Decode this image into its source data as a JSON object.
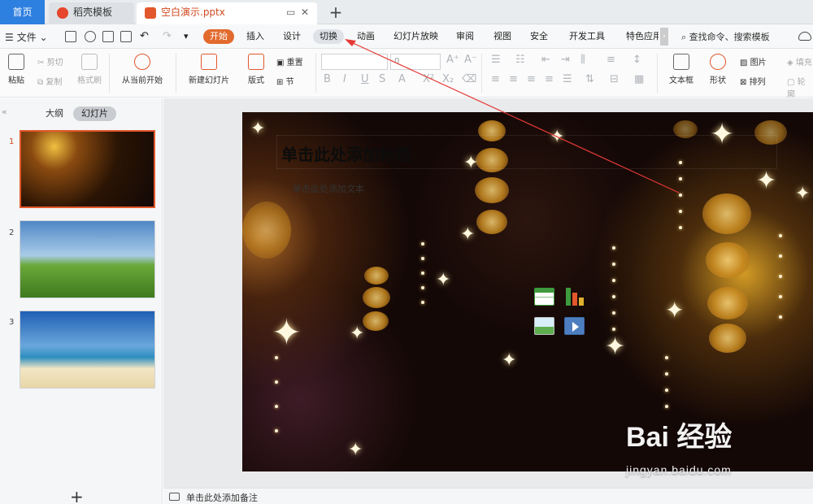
{
  "tabs": {
    "home": "首页",
    "template": "稻壳模板",
    "document": "空白演示.pptx"
  },
  "menu": {
    "file": "文件",
    "items": [
      "开始",
      "插入",
      "设计",
      "切换",
      "动画",
      "幻灯片放映",
      "审阅",
      "视图",
      "安全",
      "开发工具",
      "特色应用"
    ],
    "search": "查找命令、搜索模板",
    "active": "开始",
    "pointed": "切换"
  },
  "ribbon": {
    "paste": "粘贴",
    "cut": "剪切",
    "copy": "复制",
    "format_painter": "格式刷",
    "from_current": "从当前开始",
    "new_slide": "新建幻灯片",
    "layout": "版式",
    "reset": "重置",
    "section": "节",
    "font_size": "0",
    "text_box": "文本框",
    "shape": "形状",
    "picture": "图片",
    "arrange": "排列",
    "fill": "填充",
    "outline": "轮廓"
  },
  "panel": {
    "outline_tab": "大纲",
    "slides_tab": "幻灯片",
    "slides": [
      {
        "number": "1",
        "theme": "golden-lights"
      },
      {
        "number": "2",
        "theme": "landscape"
      },
      {
        "number": "3",
        "theme": "beach"
      }
    ],
    "add_icon": "+"
  },
  "slide": {
    "title_placeholder": "单击此处添加标题",
    "subtitle_placeholder": "单击此处添加文本"
  },
  "notes": {
    "placeholder": "单击此处添加备注"
  },
  "watermark": {
    "brand": "Bai 经验",
    "url": "jingyan.baidu.com"
  },
  "colors": {
    "accent_orange": "#e2572b",
    "home_tab_blue": "#2d7fe0",
    "arrow_red": "#e53935"
  }
}
